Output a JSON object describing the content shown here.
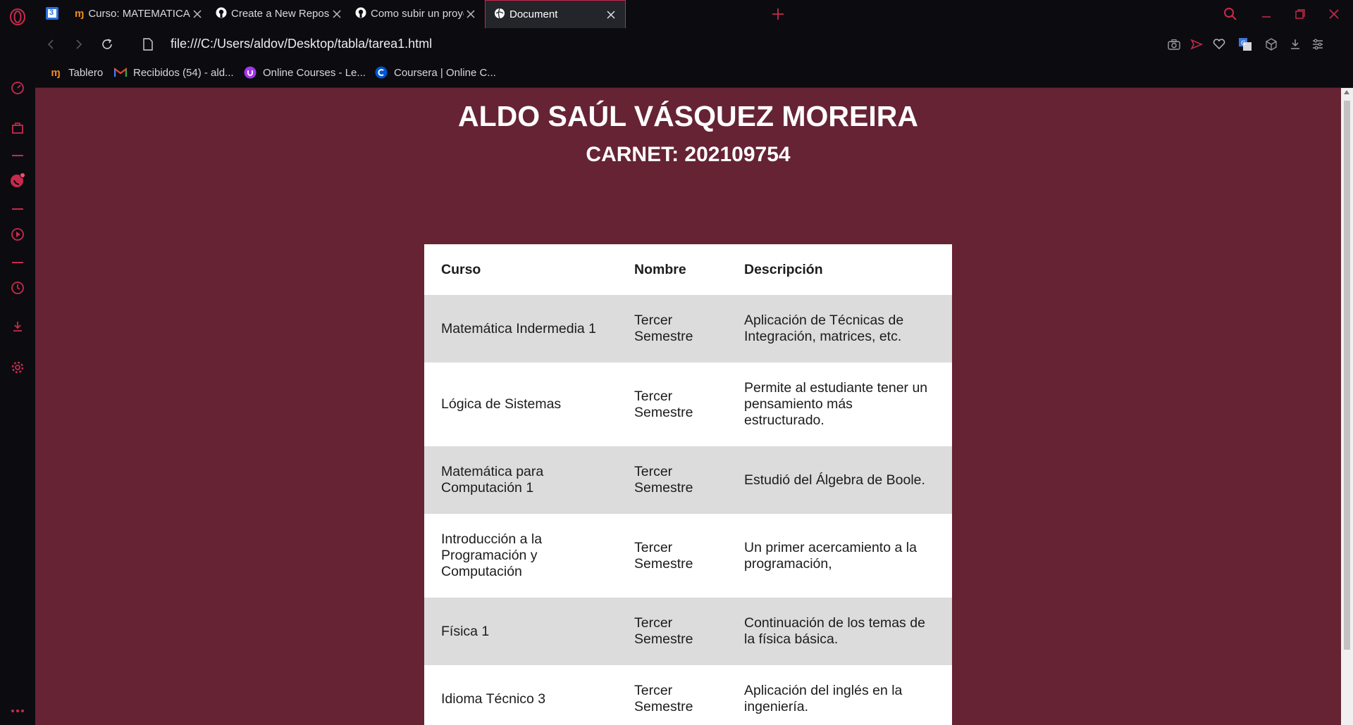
{
  "browser": {
    "pinned_tab_label": "3",
    "tabs": [
      {
        "title": "Curso: MATEMATICA PARA",
        "icon": "moodle-icon",
        "active": false
      },
      {
        "title": "Create a New Repository",
        "icon": "github-icon",
        "active": false
      },
      {
        "title": "Como subir un proyecto lo",
        "icon": "github-icon",
        "active": false
      },
      {
        "title": "Document",
        "icon": "globe-icon",
        "active": true
      }
    ],
    "url": "file:///C:/Users/aldov/Desktop/tabla/tarea1.html",
    "accent_color": "#c9294d",
    "bookmarks": [
      {
        "label": "Tablero",
        "icon": "moodle-icon"
      },
      {
        "label": "Recibidos (54) - ald...",
        "icon": "gmail-icon"
      },
      {
        "label": "Online Courses - Le...",
        "icon": "udemy-icon"
      },
      {
        "label": "Coursera | Online C...",
        "icon": "coursera-icon"
      }
    ]
  },
  "page": {
    "background": "#662334",
    "title": "ALDO SAÚL VÁSQUEZ MOREIRA",
    "subtitle": "CARNET: 202109754",
    "table": {
      "headers": [
        "Curso",
        "Nombre",
        "Descripción"
      ],
      "rows": [
        [
          "Matemática Indermedia 1",
          "Tercer Semestre",
          "Aplicación de Técnicas de Integración, matrices, etc."
        ],
        [
          "Lógica de Sistemas",
          "Tercer Semestre",
          "Permite al estudiante tener un pensamiento más estructurado."
        ],
        [
          "Matemática para Computación 1",
          "Tercer Semestre",
          "Estudió del Álgebra de Boole."
        ],
        [
          "Introducción a la Programación y Computación",
          "Tercer Semestre",
          "Un primer acercamiento a la programación,"
        ],
        [
          "Física 1",
          "Tercer Semestre",
          "Continuación de los temas de la física básica."
        ],
        [
          "Idioma Técnico 3",
          "Tercer Semestre",
          "Aplicación del inglés en la ingeniería."
        ]
      ]
    }
  }
}
